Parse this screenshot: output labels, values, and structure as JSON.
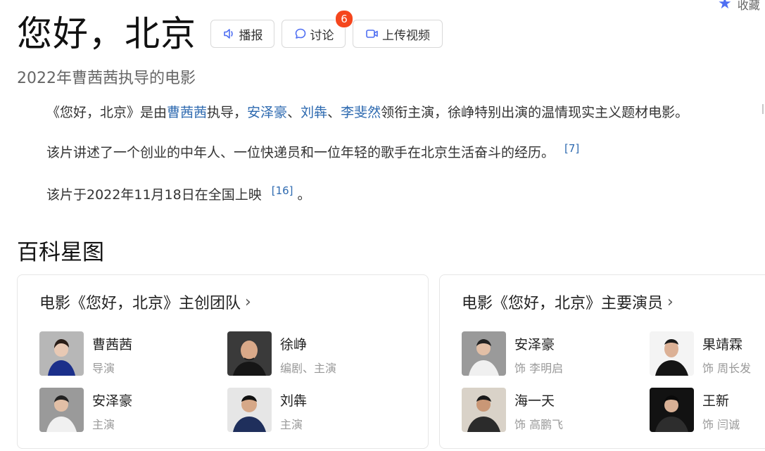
{
  "favorite": {
    "icon": "star-icon",
    "label": "收藏"
  },
  "title": "您好，北京",
  "actions": {
    "play": {
      "icon": "speaker-icon",
      "label": "播报"
    },
    "discuss": {
      "icon": "chat-bubble-icon",
      "label": "讨论",
      "badge": "6"
    },
    "upload": {
      "icon": "video-camera-icon",
      "label": "上传视频"
    }
  },
  "subtitle": "2022年曹茜茜执导的电影",
  "intro": {
    "p1": {
      "t0": "《您好，北京》是由",
      "director": "曹茜茜",
      "t1": "执导，",
      "actor1": "安泽豪",
      "sep1": "、",
      "actor2": "刘犇",
      "sep2": "、",
      "actor3": "李斐然",
      "t2": "领衔主演，徐峥特别出演的温情现实主义题材电影。"
    },
    "p2": {
      "text": "该片讲述了一个创业的中年人、一位快递员和一位年轻的歌手在北京生活奋斗的经历。",
      "ref": "[7]"
    },
    "p3": {
      "text": "该片于2022年11月18日在全国上映",
      "ref": "[16]",
      "end": "。"
    }
  },
  "starmap": {
    "title": "百科星图",
    "crew": {
      "heading": "电影《您好，北京》主创团队",
      "people": [
        {
          "name": "曹茜茜",
          "role": "导演"
        },
        {
          "name": "徐峥",
          "role": "编剧、主演"
        },
        {
          "name": "安泽豪",
          "role": "主演"
        },
        {
          "name": "刘犇",
          "role": "主演"
        }
      ]
    },
    "cast": {
      "heading": "电影《您好，北京》主要演员",
      "people": [
        {
          "name": "安泽豪",
          "role": "饰 李明启"
        },
        {
          "name": "果靖霖",
          "role": "饰 周长发"
        },
        {
          "name": "海一天",
          "role": "饰 高鹏飞"
        },
        {
          "name": "王新",
          "role": "饰 闫诚"
        }
      ]
    }
  },
  "colors": {
    "link": "#2e6ab0",
    "badge": "#f5461d",
    "star": "#4e6ef2"
  }
}
